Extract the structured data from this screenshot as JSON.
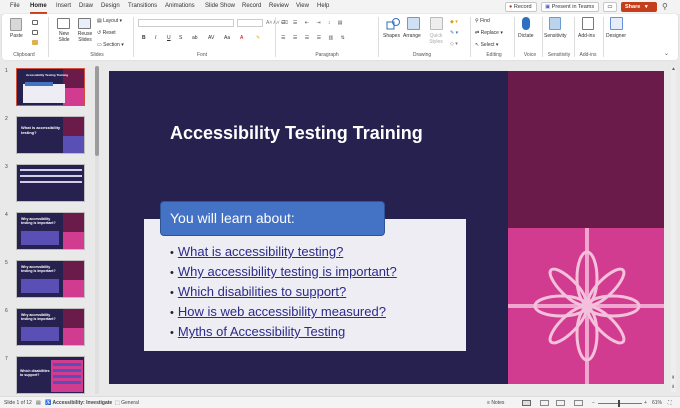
{
  "menu": {
    "tabs": [
      "File",
      "Home",
      "Insert",
      "Draw",
      "Design",
      "Transitions",
      "Animations",
      "Slide Show",
      "Record",
      "Review",
      "View",
      "Help"
    ],
    "record_label": "Record",
    "present_label": "Present in Teams",
    "share_label": "Share"
  },
  "ribbon": {
    "paste": "Paste",
    "new_slide": "New Slide",
    "reuse_slides": "Reuse Slides",
    "layout": "Layout",
    "reset": "Reset",
    "section": "Section",
    "shapes": "Shapes",
    "arrange": "Arrange",
    "quick_styles": "Quick Styles",
    "find": "Find",
    "replace": "Replace",
    "select": "Select",
    "dictate": "Dictate",
    "sensitivity": "Sensitivity",
    "addins": "Add-ins",
    "designer": "Designer",
    "groups": {
      "clipboard": "Clipboard",
      "slides": "Slides",
      "font": "Font",
      "paragraph": "Paragraph",
      "drawing": "Drawing",
      "editing": "Editing",
      "voice": "Voice",
      "sensitivity": "Sensitivity",
      "addins": "Add-ins"
    }
  },
  "thumbnails": [
    {
      "number": "1",
      "title": "Accessibility Testing Training"
    },
    {
      "number": "2",
      "title": "What is accessibility testing?"
    },
    {
      "number": "3",
      "title": ""
    },
    {
      "number": "4",
      "title": "Why accessibility testing is important?"
    },
    {
      "number": "5",
      "title": "Why accessibility testing is important?"
    },
    {
      "number": "6",
      "title": "Why accessibility testing is important?"
    },
    {
      "number": "7",
      "title": "Which disabilities to support?"
    }
  ],
  "slide": {
    "title": "Accessibility Testing Training",
    "header": "You will learn about:",
    "bullets": [
      "What is accessibility testing?",
      "Why accessibility testing is important?",
      "Which disabilities to support?",
      "How is web accessibility measured?",
      "Myths of Accessibility Testing"
    ]
  },
  "status": {
    "slide_count": "Slide 1 of 12",
    "accessibility": "Accessibility: Investigate",
    "sensitivity": "General",
    "notes": "Notes",
    "zoom": "61%"
  },
  "colors": {
    "slide_bg": "#26214f",
    "accent_magenta": "#d13c90",
    "accent_plum": "#6a1b49",
    "header_blue": "#4472c4",
    "share_red": "#c43e1c"
  }
}
